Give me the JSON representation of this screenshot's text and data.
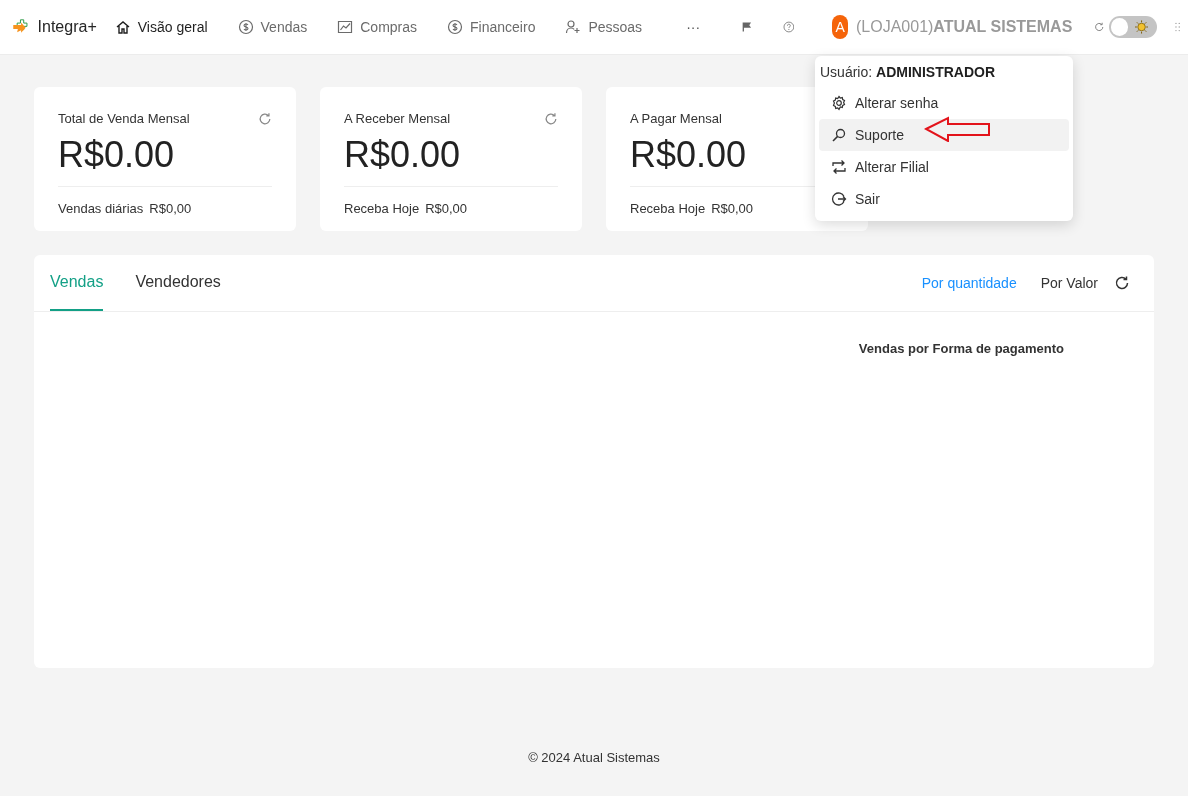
{
  "app": {
    "name": "Integra+"
  },
  "nav": [
    {
      "label": "Visão geral",
      "kind": "home",
      "selected": true
    },
    {
      "label": "Vendas",
      "kind": "dollar",
      "selected": false
    },
    {
      "label": "Compras",
      "kind": "chart",
      "selected": false
    },
    {
      "label": "Financeiro",
      "kind": "dollar",
      "selected": false
    },
    {
      "label": "Pessoas",
      "kind": "people",
      "selected": false
    }
  ],
  "nav_more": "···",
  "theme_toggle": {
    "on": false
  },
  "user": {
    "avatar": "A",
    "store": "(LOJA001)",
    "company": "ATUAL SISTEMAS"
  },
  "user_menu": {
    "user_label": "Usuário:",
    "user_name": "ADMINISTRADOR",
    "items": [
      {
        "label": "Alterar senha",
        "kind": "gear",
        "selected": false
      },
      {
        "label": "Suporte",
        "kind": "search",
        "selected": true
      },
      {
        "label": "Alterar Filial",
        "kind": "swap",
        "selected": false
      },
      {
        "label": "Sair",
        "kind": "logout",
        "selected": false
      }
    ]
  },
  "cards": [
    {
      "title": "Total de Venda Mensal",
      "value": "R$0.00",
      "footer_label": "Vendas diárias",
      "footer_value": "R$0,00"
    },
    {
      "title": "A Receber Mensal",
      "value": "R$0.00",
      "footer_label": "Receba Hoje",
      "footer_value": "R$0,00"
    },
    {
      "title": "A Pagar Mensal",
      "value": "R$0.00",
      "footer_label": "Receba Hoje",
      "footer_value": "R$0,00"
    }
  ],
  "panel": {
    "tabs": [
      {
        "label": "Vendas",
        "selected": true
      },
      {
        "label": "Vendedores",
        "selected": false
      }
    ],
    "modes": [
      {
        "label": "Por quantidade",
        "selected": true
      },
      {
        "label": "Por Valor",
        "selected": false
      }
    ],
    "chart_title": "Vendas por Forma de pagamento"
  },
  "footer": "© 2024 Atual Sistemas"
}
